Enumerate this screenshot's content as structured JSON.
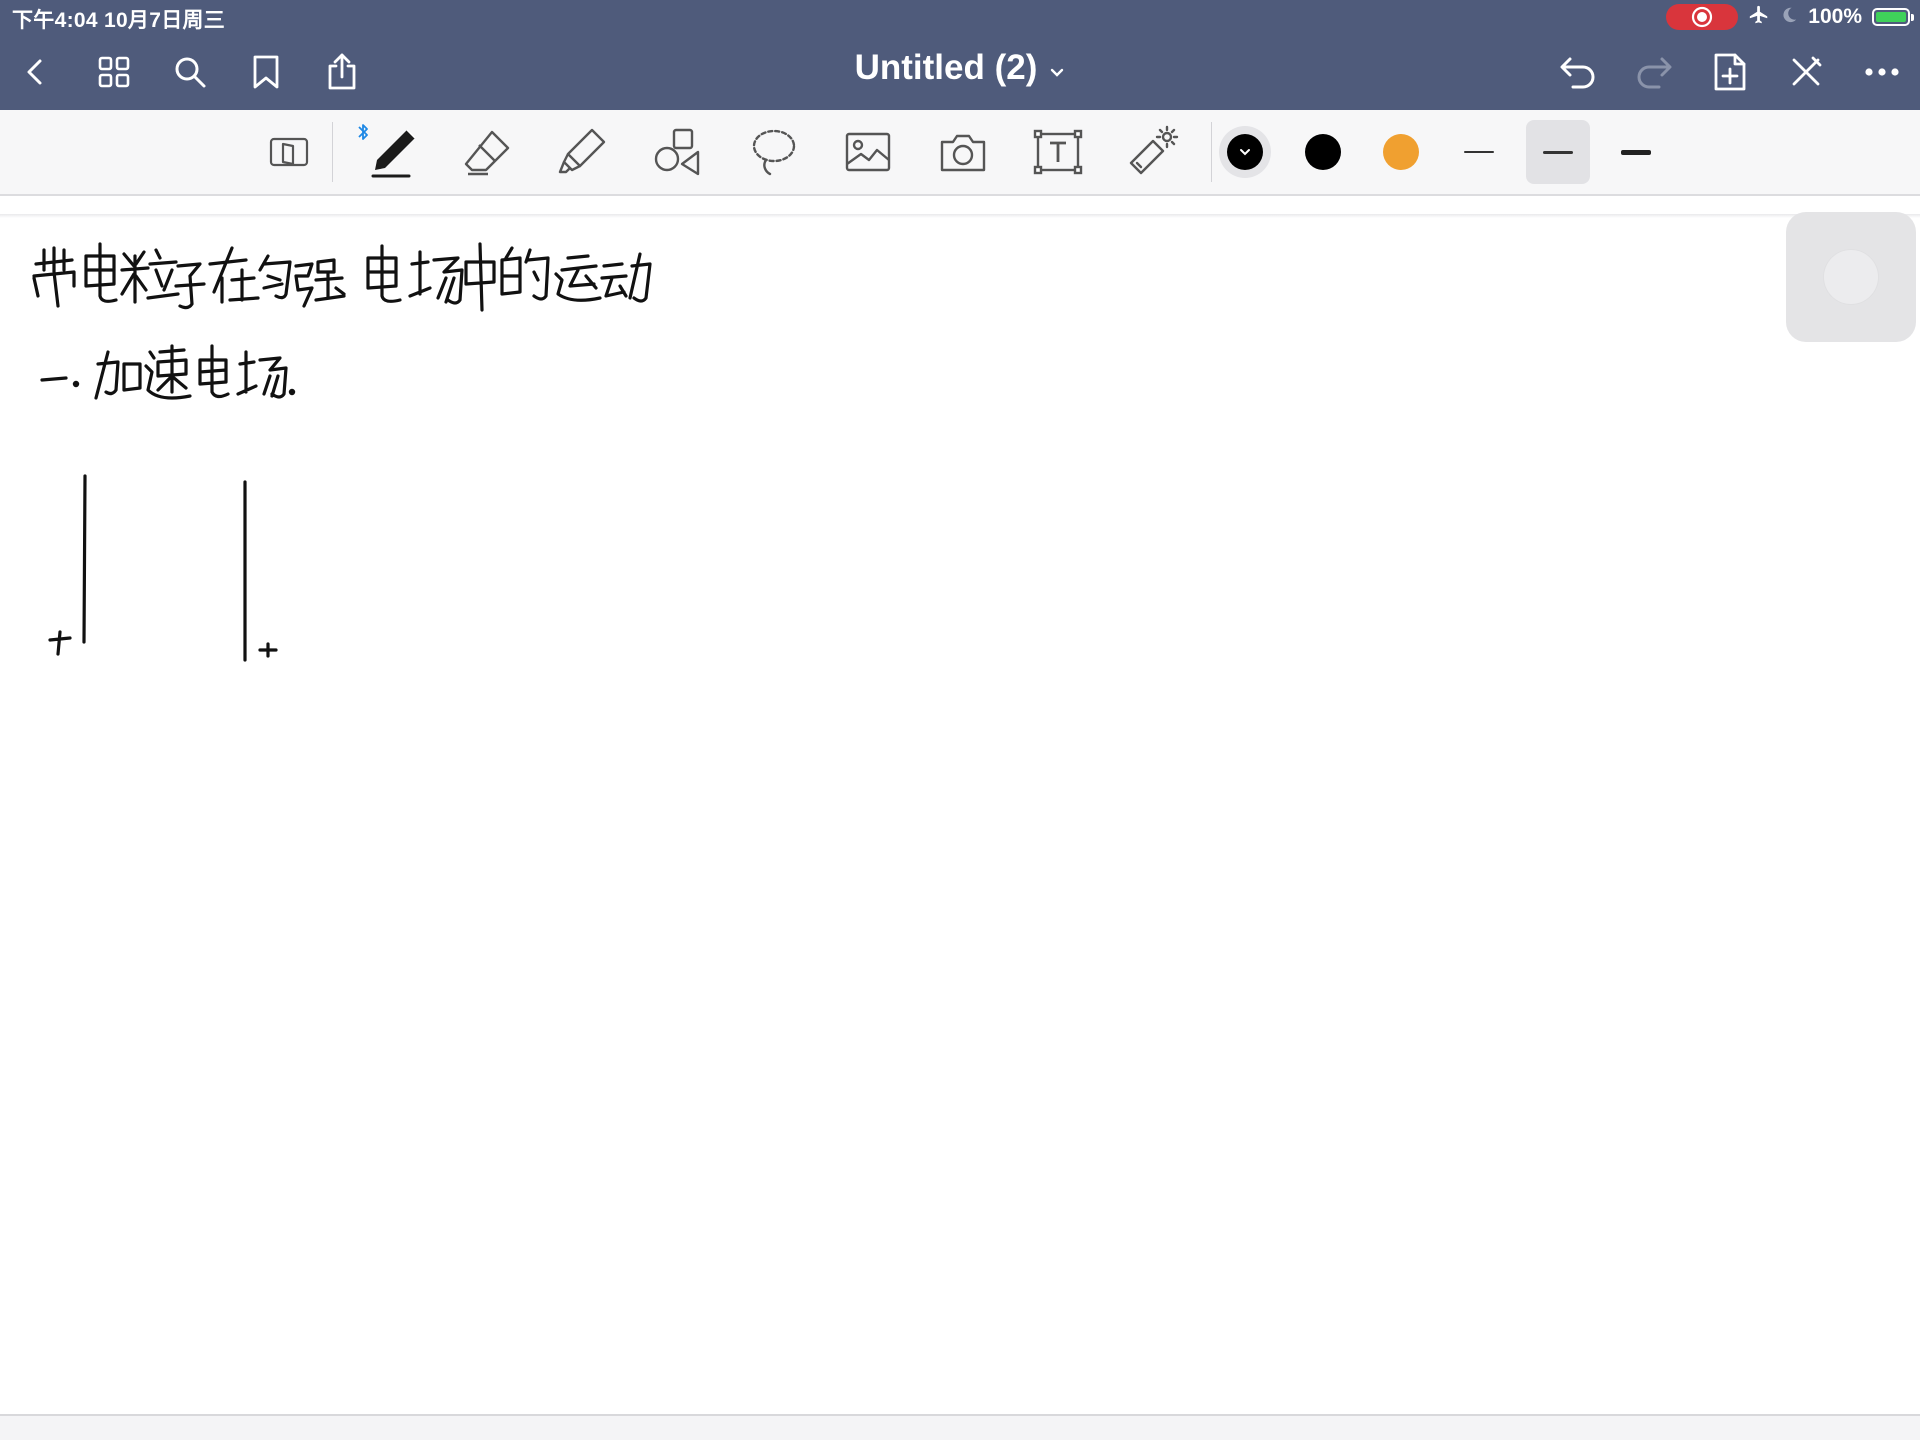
{
  "status_bar": {
    "time_date": "下午4:04   10月7日周三",
    "battery_text": "100%",
    "icons": [
      "screen-record-icon",
      "airplane-icon",
      "moon-icon",
      "battery-icon"
    ]
  },
  "nav": {
    "title": "Untitled (2)",
    "left_icons": [
      "back-icon",
      "grid-icon",
      "search-icon",
      "bookmark-icon",
      "share-icon"
    ],
    "right_icons": [
      "undo-icon",
      "redo-icon",
      "add-page-icon",
      "close-pencil-icon",
      "more-icon"
    ]
  },
  "toolbar": {
    "tools": [
      "read-only-mode",
      "pen",
      "eraser",
      "highlighter",
      "shapes",
      "lasso",
      "image",
      "camera",
      "text",
      "laser-pointer"
    ],
    "selected_tool": "pen",
    "colors": [
      "#000000",
      "#000000",
      "#f0a030"
    ],
    "selected_color_index": 0,
    "stroke_widths": [
      "thin",
      "medium",
      "thick"
    ],
    "selected_width": "medium",
    "accent": "#4f5b7b"
  }
}
